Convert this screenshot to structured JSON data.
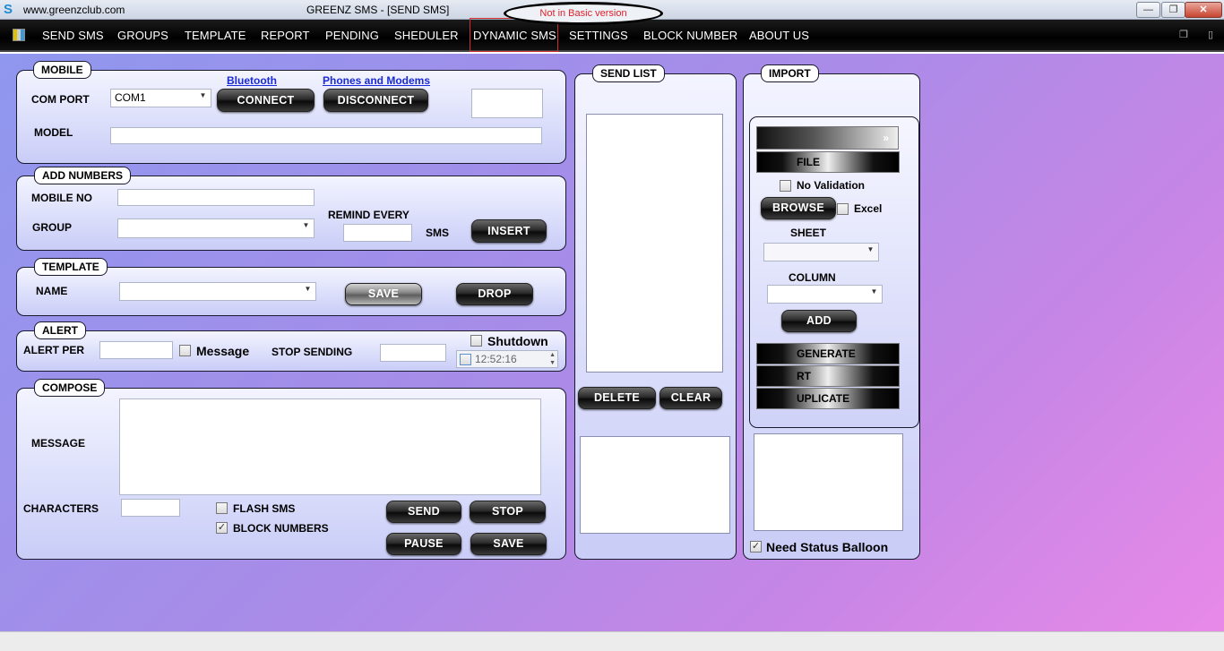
{
  "titlebar": {
    "site": "www.greenzclub.com",
    "title": "GREENZ SMS - [SEND SMS]",
    "note": "Not in Basic version"
  },
  "menu": {
    "items": [
      "SEND SMS",
      "GROUPS",
      "TEMPLATE",
      "REPORT",
      "PENDING",
      "SHEDULER",
      "DYNAMIC SMS",
      "SETTINGS",
      "BLOCK NUMBER",
      "ABOUT US"
    ]
  },
  "mobile": {
    "legend": "MOBILE",
    "com_port_label": "COM PORT",
    "com_port_value": "COM1",
    "bluetooth_link": "Bluetooth",
    "phones_link": "Phones and Modems",
    "connect": "CONNECT",
    "disconnect": "DISCONNECT",
    "model_label": "MODEL"
  },
  "add_numbers": {
    "legend": "ADD NUMBERS",
    "mobile_no_label": "MOBILE NO",
    "group_label": "GROUP",
    "remind_every_label": "REMIND EVERY",
    "sms_label": "SMS",
    "insert": "INSERT"
  },
  "template": {
    "legend": "TEMPLATE",
    "name_label": "NAME",
    "save": "SAVE",
    "drop": "DROP"
  },
  "alert": {
    "legend": "ALERT",
    "alert_per_label": "ALERT PER",
    "message_label": "Message",
    "stop_sending_label": "STOP SENDING",
    "shutdown_label": "Shutdown",
    "time_value": "12:52:16"
  },
  "compose": {
    "legend": "COMPOSE",
    "message_label": "MESSAGE",
    "characters_label": "CHARACTERS",
    "flash_sms_label": "FLASH SMS",
    "block_numbers_label": "BLOCK NUMBERS",
    "block_numbers_checked": true,
    "send": "SEND",
    "stop": "STOP",
    "pause": "PAUSE",
    "save": "SAVE"
  },
  "send_list": {
    "legend": "SEND LIST",
    "delete": "DELETE",
    "clear": "CLEAR"
  },
  "import": {
    "legend": "IMPORT",
    "expand": "»",
    "file_strip": "FILE",
    "no_validation_label": "No Validation",
    "browse": "BROWSE",
    "excel_label": "Excel",
    "sheet_label": "SHEET",
    "column_label": "COLUMN",
    "add": "ADD",
    "generate_strip": "GENERATE",
    "rt_strip": "RT",
    "duplicate_strip": "UPLICATE",
    "need_status_label": "Need Status Balloon",
    "need_status_checked": true
  }
}
